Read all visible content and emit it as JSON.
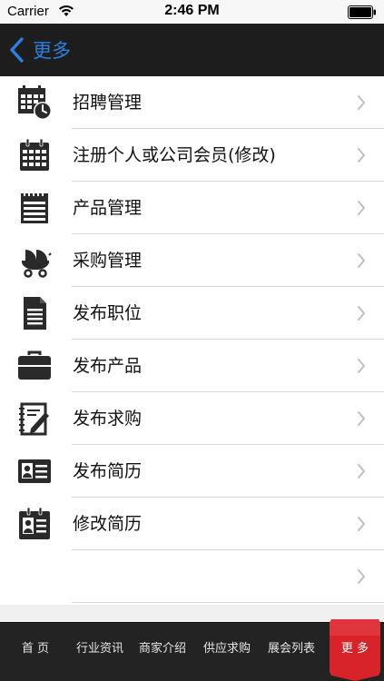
{
  "status_bar": {
    "carrier": "Carrier",
    "time": "2:46 PM"
  },
  "nav": {
    "back_label": "更多"
  },
  "menu": {
    "items": [
      {
        "label": "招聘管理",
        "icon": "calendar-clock-icon"
      },
      {
        "label": "注册个人或公司会员(修改)",
        "icon": "calendar-grid-icon"
      },
      {
        "label": "产品管理",
        "icon": "notepad-icon"
      },
      {
        "label": "采购管理",
        "icon": "baby-stroller-icon"
      },
      {
        "label": "发布职位",
        "icon": "document-icon"
      },
      {
        "label": "发布产品",
        "icon": "briefcase-icon"
      },
      {
        "label": "发布求购",
        "icon": "notepad-pencil-icon"
      },
      {
        "label": "发布简历",
        "icon": "id-card-icon"
      },
      {
        "label": "修改简历",
        "icon": "id-badge-icon"
      },
      {
        "label": "",
        "icon": ""
      }
    ]
  },
  "tabs": {
    "items": [
      {
        "label": "首 页"
      },
      {
        "label": "行业资讯"
      },
      {
        "label": "商家介绍"
      },
      {
        "label": "供应求购"
      },
      {
        "label": "展会列表"
      },
      {
        "label": "更 多"
      }
    ],
    "active_color": "#d8232a"
  }
}
